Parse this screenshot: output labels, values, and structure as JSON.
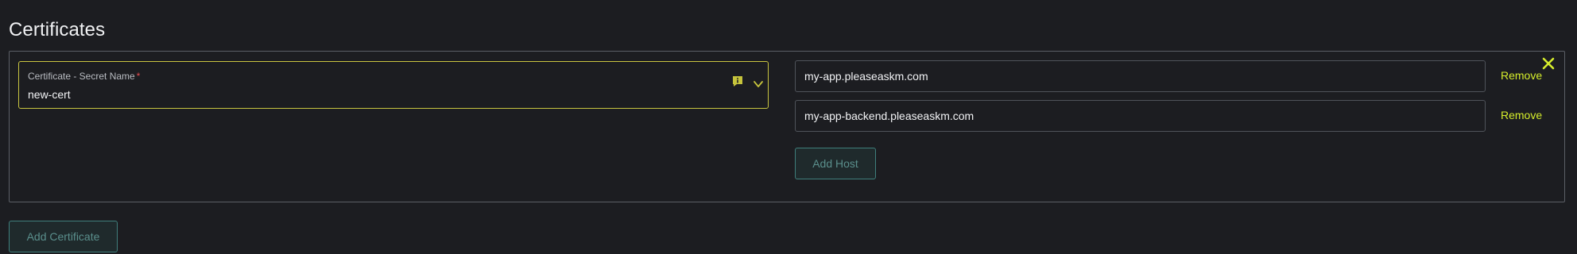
{
  "section": {
    "title": "Certificates"
  },
  "certificate": {
    "secret_label": "Certificate - Secret Name",
    "required_marker": "*",
    "secret_value": "new-cert",
    "hosts": [
      {
        "value": "my-app.pleaseaskm.com",
        "remove_label": "Remove"
      },
      {
        "value": "my-app-backend.pleaseaskm.com",
        "remove_label": "Remove"
      }
    ],
    "add_host_label": "Add Host"
  },
  "actions": {
    "add_certificate_label": "Add Certificate"
  },
  "colors": {
    "background": "#1c1d21",
    "accent": "#d6ee2b",
    "focus_border": "#c9c540",
    "required": "#e5484d",
    "teal_button": "#3f7f7c"
  },
  "icons": {
    "close": "close-icon",
    "info": "info-icon",
    "chevron": "chevron-down-icon"
  }
}
